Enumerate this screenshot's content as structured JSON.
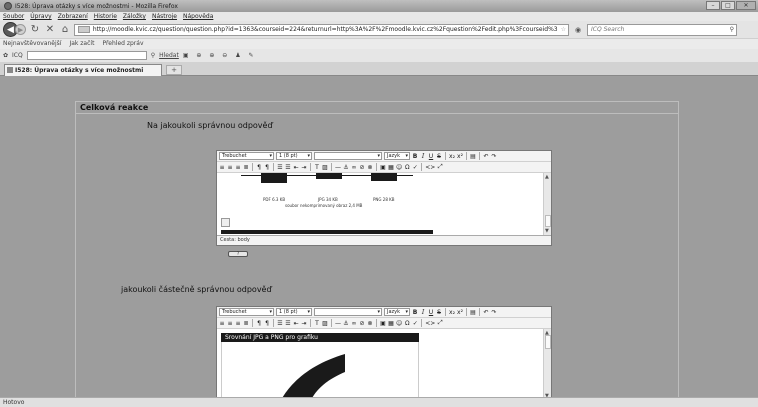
{
  "window": {
    "title": "I528: Úprava otázky s více možnostmi - Mozilla Firefox"
  },
  "menubar": [
    "Soubor",
    "Úpravy",
    "Zobrazení",
    "Historie",
    "Záložky",
    "Nástroje",
    "Nápověda"
  ],
  "nav": {
    "url": "http://moodle.kvic.cz/question/question.php?id=1363&courseid=224&returnurl=http%3A%2F%2Fmoodle.kvic.cz%2Fquestion%2Fedit.php%3Fcourseid%3",
    "search_placeholder": "ICQ Search"
  },
  "bookmarks": [
    "Nejnavštěvovanější",
    "Jak začít",
    "Přehled zpráv"
  ],
  "icq": {
    "label": "ICQ",
    "search": "Hledat"
  },
  "tab": {
    "label": "I528: Úprava otázky s více možnostmi",
    "new": "+"
  },
  "section": {
    "heading": "Celková reakce",
    "q1": "Na jakoukoli správnou odpověď",
    "q2": "jakoukoli částečně správnou odpověď"
  },
  "editor": {
    "font": "Trebuchet",
    "size": "1 (8 pt)",
    "format": "",
    "lang": "Jazyk",
    "path_label": "Cesta:",
    "path_value": "body",
    "files": [
      "PDF 6.3 KB",
      "JPG 34 KB",
      "PNG 28 KB"
    ],
    "caption": "soubor nekomprimovaný obraz 2,4 MB",
    "image_title": "Srovnání JPG a PNG pro grafiku"
  },
  "status": "Hotovo"
}
